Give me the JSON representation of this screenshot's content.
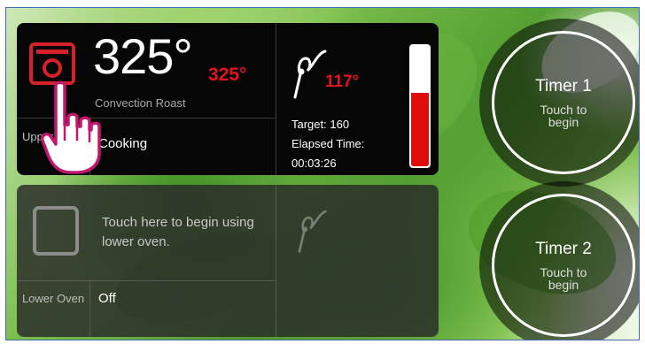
{
  "upper_oven": {
    "label": "Upper Oven",
    "current_temp": "325°",
    "set_temp": "325°",
    "mode": "Convection Roast",
    "status": "Cooking",
    "probe": {
      "temp": "117°",
      "target": "Target: 160",
      "elapsed_label": "Elapsed Time:",
      "elapsed_value": "00:03:26",
      "fill_fraction": 0.62
    }
  },
  "lower_oven": {
    "prompt": "Touch here to begin using lower oven.",
    "label": "Lower Oven",
    "status": "Off"
  },
  "timers": [
    {
      "title": "Timer 1",
      "subtitle": "Touch to begin"
    },
    {
      "title": "Timer 2",
      "subtitle": "Touch to begin"
    }
  ],
  "colors": {
    "accent_red": "#e3141d",
    "card_bg": "#060606"
  }
}
